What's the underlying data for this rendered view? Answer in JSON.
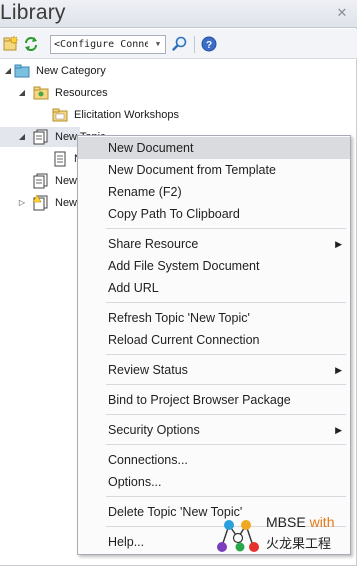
{
  "window": {
    "title": "Library"
  },
  "toolbar": {
    "combo_value": "<Configure Conne"
  },
  "tree": {
    "items": [
      {
        "label": "New Category",
        "level": 0
      },
      {
        "label": "Resources",
        "level": 1
      },
      {
        "label": "Elicitation Workshops",
        "level": 2
      },
      {
        "label": "New Topic",
        "level": 1
      },
      {
        "label": "N",
        "level": 2
      },
      {
        "label": "New",
        "level": 1
      },
      {
        "label": "New",
        "level": 1
      }
    ]
  },
  "context_menu": {
    "items": [
      {
        "label": "New Document",
        "highlighted": true
      },
      {
        "label": "New Document from Template"
      },
      {
        "label": "Rename (F2)"
      },
      {
        "label": "Copy Path To Clipboard"
      },
      {
        "label": "Share Resource",
        "submenu": true
      },
      {
        "label": "Add File System Document"
      },
      {
        "label": "Add URL"
      },
      {
        "label": "Refresh Topic 'New Topic'"
      },
      {
        "label": "Reload Current Connection"
      },
      {
        "label": "Review Status",
        "submenu": true
      },
      {
        "label": "Bind to Project Browser Package"
      },
      {
        "label": "Security Options",
        "submenu": true
      },
      {
        "label": "Connections..."
      },
      {
        "label": "Options..."
      },
      {
        "label": "Delete Topic 'New Topic'"
      },
      {
        "label": "Help..."
      }
    ]
  },
  "watermark": {
    "line1": "MBSE ",
    "with": "with",
    "line2": "火龙果工程"
  },
  "colors": {
    "accent_blue": "#2e6fba",
    "watermark_orange": "#e47a18",
    "highlight": "#d9dbdf"
  }
}
